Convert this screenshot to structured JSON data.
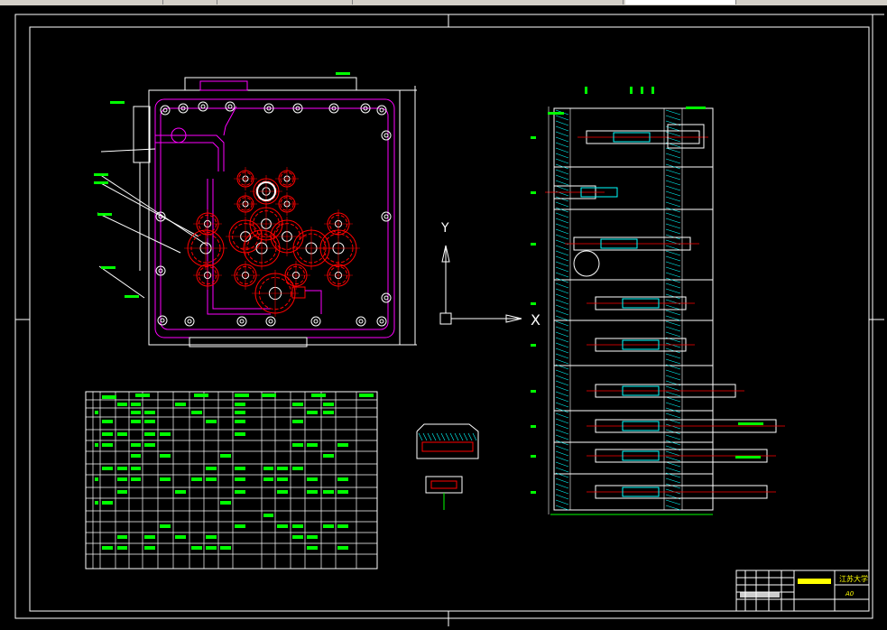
{
  "window": {
    "type": "cad-model-space",
    "background": "#000000"
  },
  "colors": {
    "frame": "#ffffff",
    "magenta": "#ff00ff",
    "red": "#ff0000",
    "green": "#00ff00",
    "cyan": "#00ffff",
    "yellow": "#ffff00",
    "menubar": "#d4d0c8"
  },
  "ucs": {
    "y_label": "Y",
    "x_label": "X"
  },
  "title_block": {
    "school": "江苏大学",
    "sheet_code": "A0"
  }
}
